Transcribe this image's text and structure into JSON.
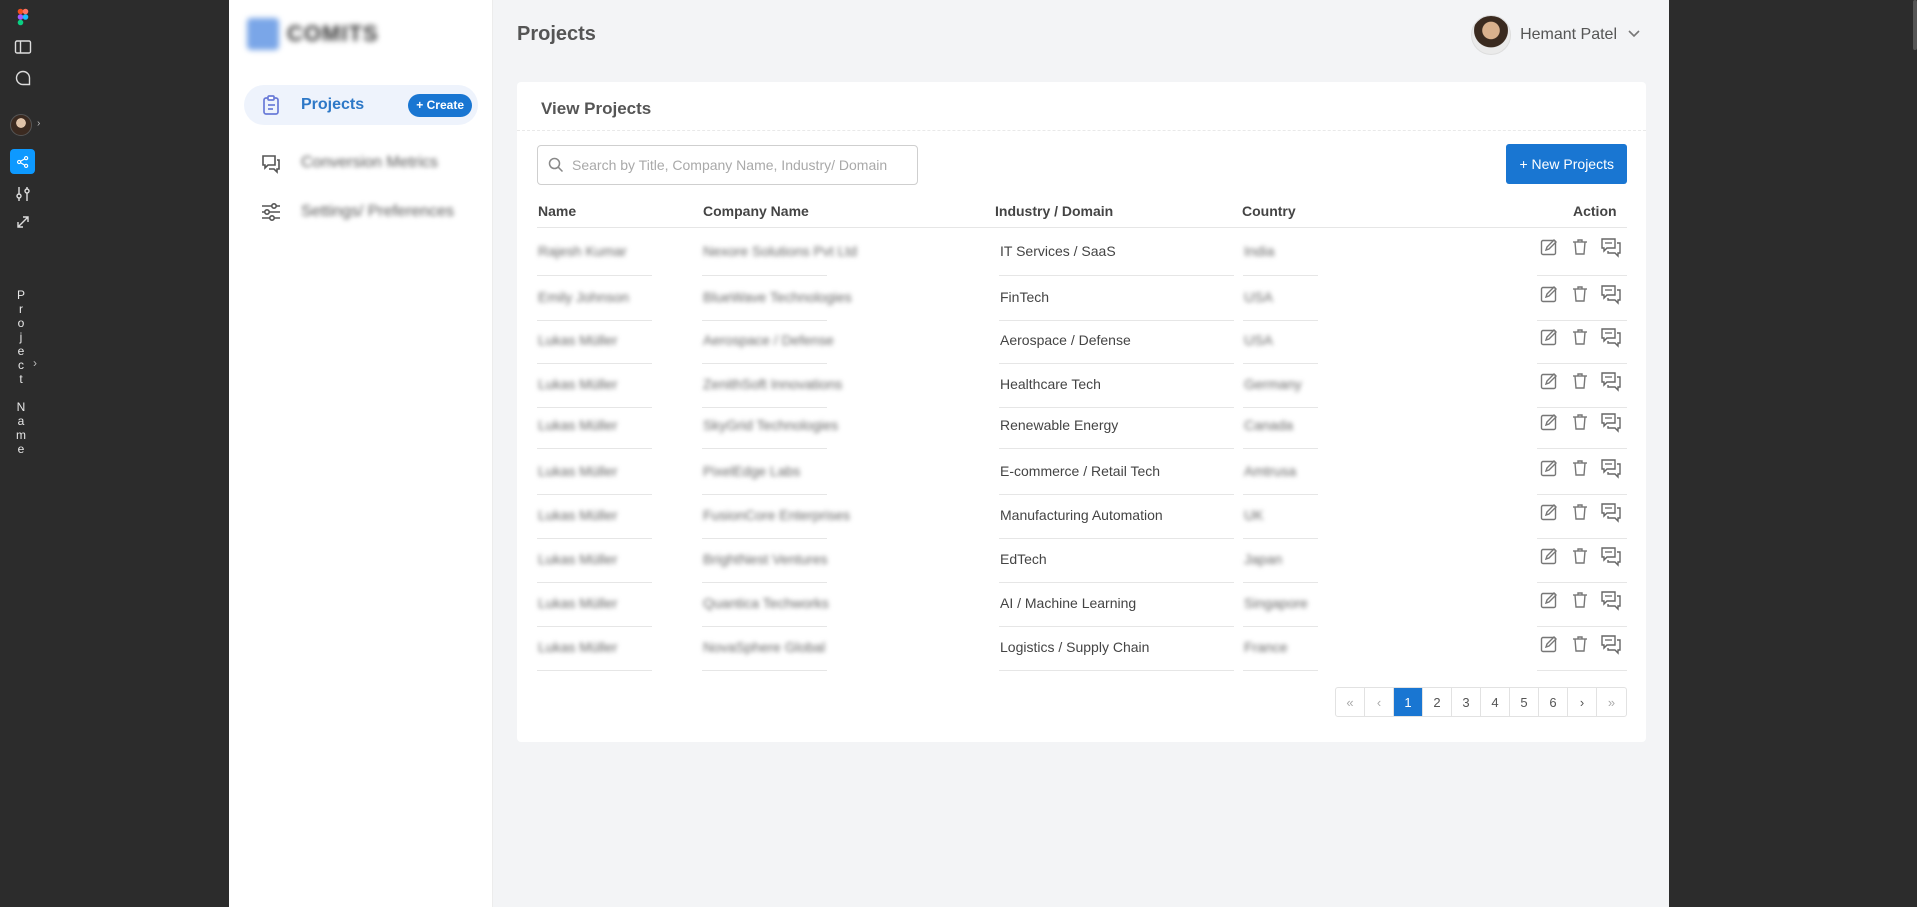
{
  "figma_toolbar": {
    "vertical_label": "Project Name",
    "accent_color": "#0d99ff"
  },
  "sidebar": {
    "logo_text": "COMITS",
    "items": [
      {
        "label": "Projects",
        "icon": "clipboard-icon",
        "active": true,
        "badge": "+ Create"
      },
      {
        "label": "Conversion Metrics",
        "icon": "chat-bubbles-icon",
        "active": false
      },
      {
        "label": "Settings/ Preferences",
        "icon": "sliders-icon",
        "active": false
      }
    ]
  },
  "header": {
    "title": "Projects",
    "user_name": "Hemant Patel"
  },
  "card": {
    "title": "View Projects",
    "search_placeholder": "Search by Title, Company Name, Industry/ Domain",
    "new_button": "+ New Projects",
    "columns": [
      "Name",
      "Company Name",
      "Industry / Domain",
      "Country",
      "Action"
    ],
    "rows": [
      {
        "name": "Rajesh Kumar",
        "company": "Nexore Solutions Pvt Ltd",
        "industry": "IT Services / SaaS",
        "country": "India"
      },
      {
        "name": "Emily Johnson",
        "company": "BlueWave Technologies",
        "industry": "FinTech",
        "country": "USA"
      },
      {
        "name": "Lukas Müller",
        "company": "Aerospace / Defense",
        "industry": "Aerospace / Defense",
        "country": "USA"
      },
      {
        "name": "Lukas Müller",
        "company": "ZenithSoft Innovations",
        "industry": "Healthcare Tech",
        "country": "Germany"
      },
      {
        "name": "Lukas Müller",
        "company": "SkyGrid Technologies",
        "industry": "Renewable Energy",
        "country": "Canada"
      },
      {
        "name": "Lukas Müller",
        "company": "PixelEdge Labs",
        "industry": "E-commerce / Retail Tech",
        "country": "Amtrusa"
      },
      {
        "name": "Lukas Müller",
        "company": "FusionCore Enterprises",
        "industry": "Manufacturing Automation",
        "country": "UK"
      },
      {
        "name": "Lukas Müller",
        "company": "BrightNest Ventures",
        "industry": "EdTech",
        "country": "Japan"
      },
      {
        "name": "Lukas Müller",
        "company": "Quantica Techworks",
        "industry": "AI / Machine Learning",
        "country": "Singapore"
      },
      {
        "name": "Lukas Müller",
        "company": "NovaSphere Global",
        "industry": "Logistics / Supply Chain",
        "country": "France"
      }
    ],
    "pagination": {
      "first": "«",
      "prev": "‹",
      "pages": [
        "1",
        "2",
        "3",
        "4",
        "5",
        "6"
      ],
      "current": "1",
      "next": "›",
      "last": "»"
    }
  },
  "colors": {
    "primary": "#1976d2",
    "active_nav_bg": "#eef3fc",
    "page_bg": "#f3f4f6"
  }
}
